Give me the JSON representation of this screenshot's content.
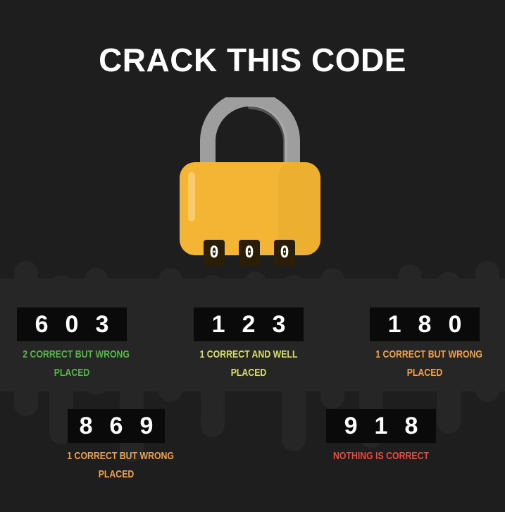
{
  "title": "CRACK THIS CODE",
  "lock": {
    "dials": [
      "0",
      "0",
      "0"
    ],
    "shackle_color": "#9e9e9e",
    "body_color": "#f5b534",
    "icon": "padlock-icon"
  },
  "clues": [
    {
      "digits": [
        "6",
        "0",
        "3"
      ],
      "hint_line1": "2 CORRECT BUT WRONG",
      "hint_line2": "PLACED",
      "color": "#57b84a"
    },
    {
      "digits": [
        "1",
        "2",
        "3"
      ],
      "hint_line1": "1 CORRECT AND WELL",
      "hint_line2": "PLACED",
      "color": "#d8e06a"
    },
    {
      "digits": [
        "1",
        "8",
        "0"
      ],
      "hint_line1": "1 CORRECT BUT WRONG",
      "hint_line2": "PLACED",
      "color": "#f0a347"
    },
    {
      "digits": [
        "8",
        "6",
        "9"
      ],
      "hint_line1": "1 CORRECT BUT WRONG",
      "hint_line2": "PLACED",
      "color": "#f0a347"
    },
    {
      "digits": [
        "9",
        "1",
        "8"
      ],
      "hint_line1": "NOTHING IS CORRECT",
      "hint_line2": "",
      "color": "#e84b3c"
    }
  ]
}
